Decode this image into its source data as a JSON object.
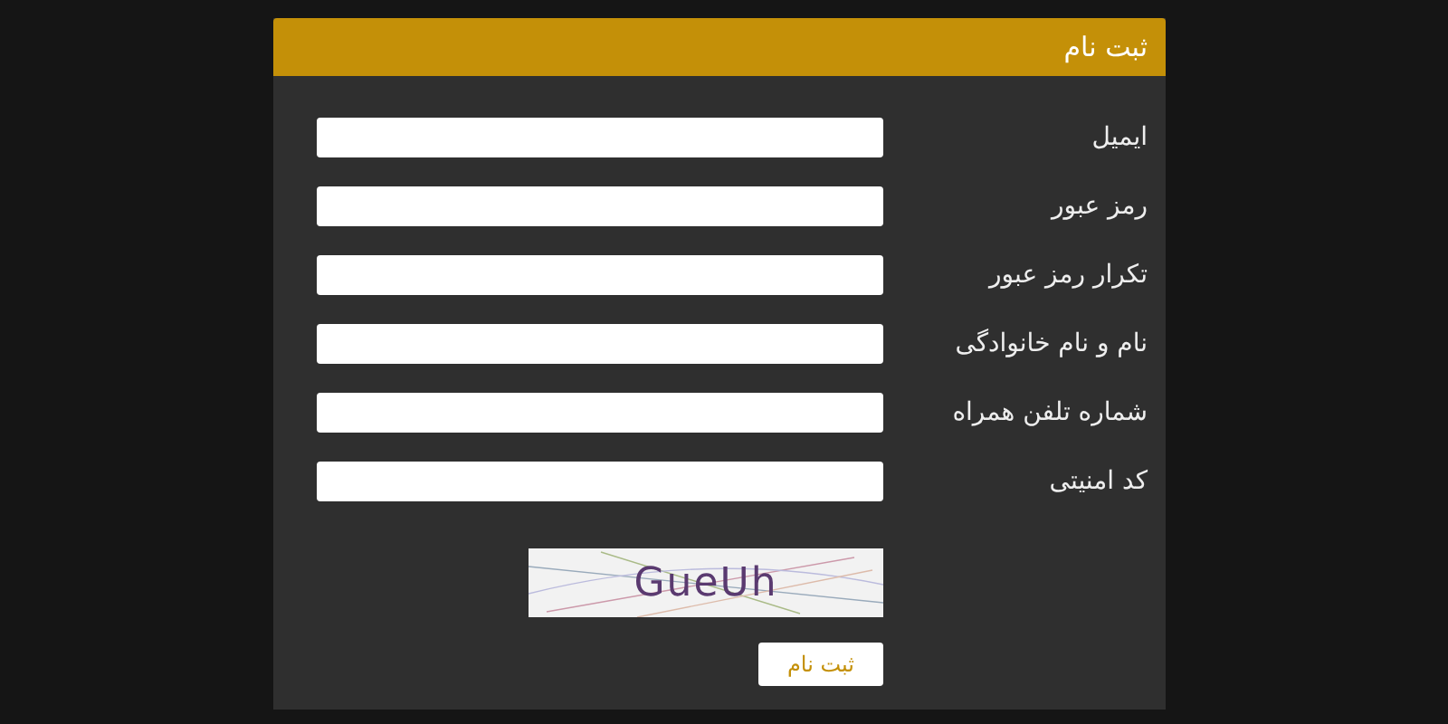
{
  "form": {
    "title": "ثبت نام",
    "fields": [
      {
        "label": "ایمیل"
      },
      {
        "label": "رمز عبور"
      },
      {
        "label": "تکرار رمز عبور"
      },
      {
        "label": "نام و نام خانوادگی"
      },
      {
        "label": "شماره تلفن همراه"
      },
      {
        "label": "کد امنیتی"
      }
    ],
    "captcha": {
      "text": "GueUh"
    },
    "submit": "ثبت نام"
  }
}
